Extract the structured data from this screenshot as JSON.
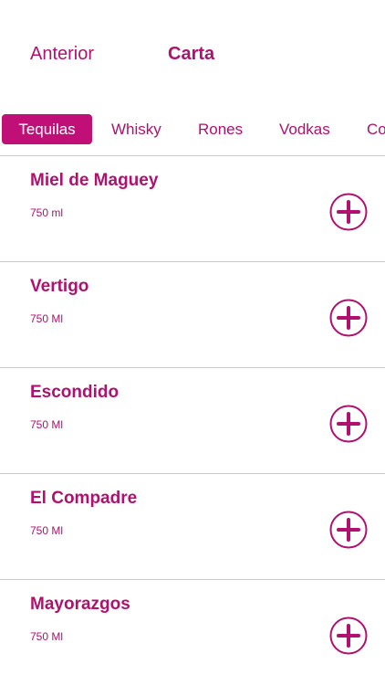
{
  "header": {
    "back_label": "Anterior",
    "title": "Carta"
  },
  "tabs": [
    {
      "label": "Tequilas",
      "active": true
    },
    {
      "label": "Whisky",
      "active": false
    },
    {
      "label": "Rones",
      "active": false
    },
    {
      "label": "Vodkas",
      "active": false
    },
    {
      "label": "Co",
      "active": false
    }
  ],
  "products": [
    {
      "name": "Miel de Maguey",
      "size": "750 ml"
    },
    {
      "name": "Vertigo",
      "size": "750 Ml"
    },
    {
      "name": "Escondido",
      "size": "750 Ml"
    },
    {
      "name": "El Compadre",
      "size": "750 Ml"
    },
    {
      "name": "Mayorazgos",
      "size": "750 Ml"
    }
  ],
  "icons": {
    "add": "plus-circle-icon"
  },
  "colors": {
    "accent": "#b0106e",
    "active_tab_bg": "#c01078",
    "divider": "#c8c8c8"
  }
}
